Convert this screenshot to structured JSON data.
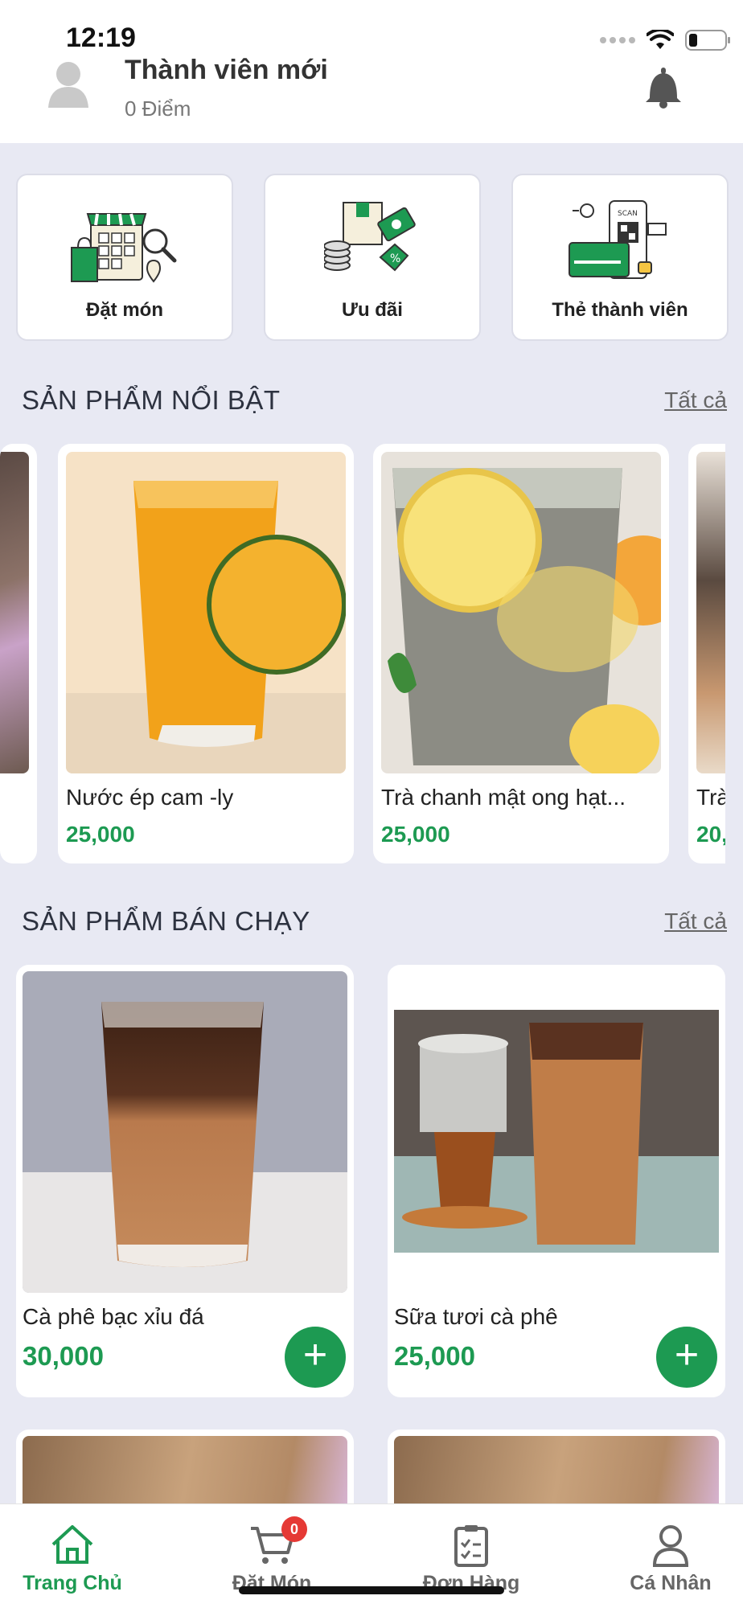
{
  "status_bar": {
    "time": "12:19"
  },
  "header": {
    "user_name": "Thành viên mới",
    "points": "0 Điểm"
  },
  "shortcuts": [
    {
      "label": "Đặt món",
      "icon": "store-icon"
    },
    {
      "label": "Ưu đãi",
      "icon": "promotion-icon"
    },
    {
      "label": "Thẻ thành viên",
      "icon": "member-card-icon"
    }
  ],
  "featured": {
    "title": "SẢN PHẨM NỔI BẬT",
    "see_all": "Tất cả",
    "items": [
      {
        "name": "Nước ép cam -ly",
        "price": "25,000"
      },
      {
        "name": "Trà chanh mật ong hạt...",
        "price": "25,000"
      },
      {
        "name": "Trà",
        "price": "20,"
      }
    ]
  },
  "best_sellers": {
    "title": "SẢN PHẨM BÁN CHẠY",
    "see_all": "Tất cả",
    "items": [
      {
        "name": "Cà phê bạc xỉu đá",
        "price": "30,000"
      },
      {
        "name": "Sữa tươi cà phê",
        "price": "25,000"
      }
    ]
  },
  "bottom_nav": {
    "items": [
      {
        "label": "Trang Chủ",
        "icon": "home-icon",
        "active": true
      },
      {
        "label": "Đặt Món",
        "icon": "cart-icon",
        "active": false
      },
      {
        "label": "Đơn Hàng",
        "icon": "clipboard-icon",
        "active": false
      },
      {
        "label": "Cá Nhân",
        "icon": "person-icon",
        "active": false
      }
    ],
    "cart_badge": "0"
  },
  "colors": {
    "accent": "#1d9a52",
    "background": "#e8e9f3",
    "badge": "#e53935"
  }
}
